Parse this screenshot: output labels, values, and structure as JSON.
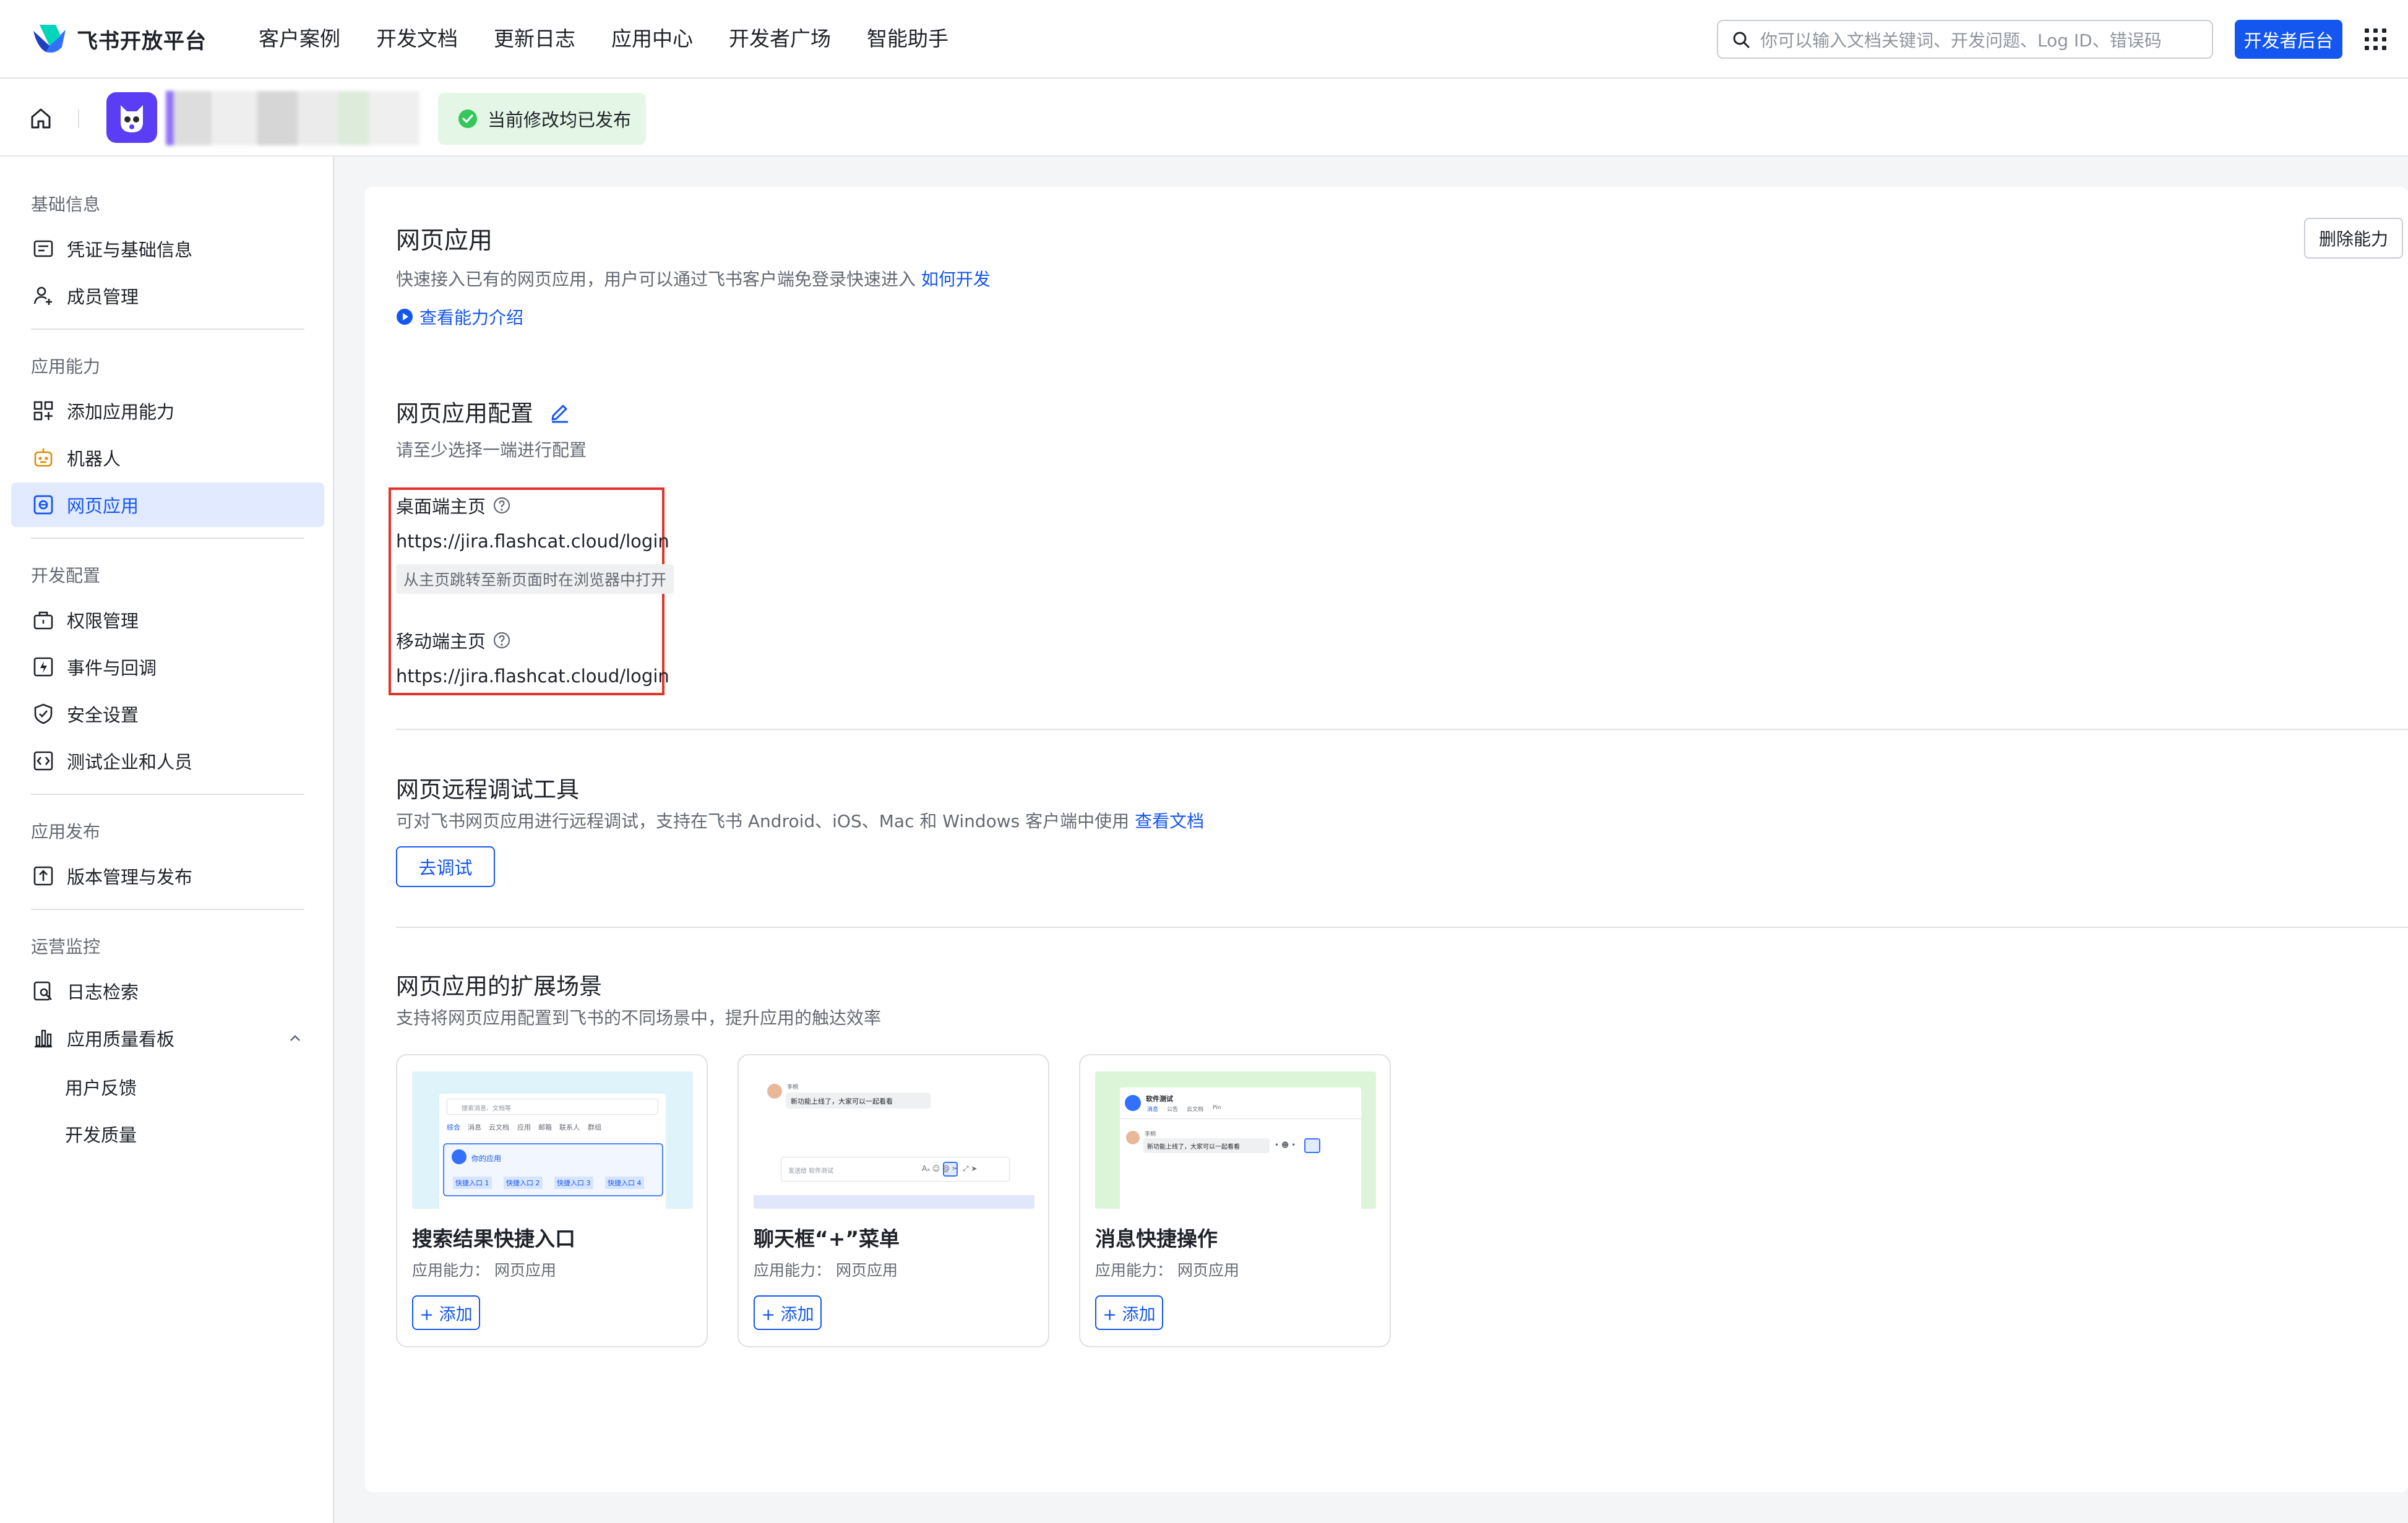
{
  "topnav": {
    "brand": "飞书开放平台",
    "links": [
      "客户案例",
      "开发文档",
      "更新日志",
      "应用中心",
      "开发者广场",
      "智能助手"
    ],
    "search_placeholder": "你可以输入文档关键词、开发问题、Log ID、错误码",
    "dev_console_label": "开发者后台",
    "accent_color": "#1456f0"
  },
  "subhead": {
    "status_text": "当前修改均已发布",
    "status_color": "#34c759"
  },
  "sidebar": {
    "groups": {
      "basic": "基础信息",
      "capabilities": "应用能力",
      "dev_config": "开发配置",
      "release": "应用发布",
      "ops": "运营监控"
    },
    "items": {
      "credentials": "凭证与基础信息",
      "members": "成员管理",
      "add_capability": "添加应用能力",
      "bot": "机器人",
      "web_app": "网页应用",
      "permissions": "权限管理",
      "events": "事件与回调",
      "security": "安全设置",
      "test_org": "测试企业和人员",
      "versions": "版本管理与发布",
      "logs": "日志检索",
      "quality_board": "应用质量看板",
      "feedback": "用户反馈",
      "dev_quality": "开发质量"
    }
  },
  "main": {
    "title": "网页应用",
    "desc": "快速接入已有的网页应用，用户可以通过飞书客户端免登录快速进入",
    "how_to_link": "如何开发",
    "intro_link": "查看能力介绍",
    "delete_label": "删除能力",
    "config": {
      "title": "网页应用配置",
      "hint": "请至少选择一端进行配置",
      "desktop_label": "桌面端主页",
      "desktop_url": "https://jira.flashcat.cloud/login",
      "desktop_tag": "从主页跳转至新页面时在浏览器中打开",
      "mobile_label": "移动端主页",
      "mobile_url": "https://jira.flashcat.cloud/login"
    },
    "debug": {
      "title": "网页远程调试工具",
      "desc": "可对飞书网页应用进行远程调试，支持在飞书 Android、iOS、Mac 和 Windows 客户端中使用",
      "doc_link": "查看文档",
      "button": "去调试"
    },
    "scenes": {
      "title": "网页应用的扩展场景",
      "desc": "支持将网页应用配置到飞书的不同场景中，提升应用的触达效率",
      "cards": [
        {
          "title": "搜索结果快捷入口",
          "sub": "应用能力：  网页应用",
          "add": "+ 添加"
        },
        {
          "title": "聊天框“+”菜单",
          "sub": "应用能力：  网页应用",
          "add": "+ 添加"
        },
        {
          "title": "消息快捷操作",
          "sub": "应用能力：  网页应用",
          "add": "+ 添加"
        }
      ],
      "preview1": {
        "search": "搜索消息、文档等",
        "tabs": [
          "综合",
          "消息",
          "云文档",
          "应用",
          "邮箱",
          "联系人",
          "群组"
        ],
        "app_name": "你的应用",
        "entries": [
          "快捷入口 1",
          "快捷入口 2",
          "快捷入口 3",
          "快捷入口 4"
        ]
      },
      "preview2": {
        "sender": "李桐",
        "message": "新功能上线了，大家可以一起看看",
        "input": "发送给 软件测试"
      },
      "preview3": {
        "group": "软件测试",
        "tabs": [
          "消息",
          "公告",
          "云文档",
          "Pin"
        ],
        "sender": "李桐",
        "message": "新功能上线了，大家可以一起看看"
      }
    }
  }
}
